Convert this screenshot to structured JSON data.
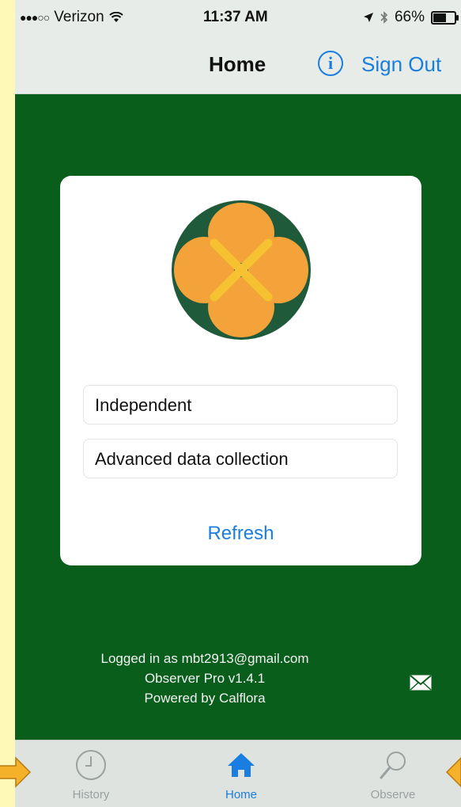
{
  "status": {
    "carrier": "Verizon",
    "time": "11:37 AM",
    "battery": "66%",
    "battery_level": 0.66
  },
  "nav": {
    "title": "Home",
    "info_icon": "info-circle-icon",
    "sign_out": "Sign Out"
  },
  "card": {
    "logo_icon": "calflora-logo",
    "field1": "Independent",
    "field2": "Advanced data collection",
    "refresh": "Refresh"
  },
  "footer": {
    "line1": "Logged in as mbt2913@gmail.com",
    "line2": "Observer Pro v1.4.1",
    "line3": "Powered by Calflora"
  },
  "tabs": [
    {
      "label": "History",
      "icon": "clock-icon"
    },
    {
      "label": "Home",
      "icon": "home-icon"
    },
    {
      "label": "Observe",
      "icon": "magnifier-icon"
    }
  ],
  "colors": {
    "accent": "#1a7ee0",
    "main_bg": "#0a5e1c",
    "logo_orange": "#f4a23a",
    "logo_yellow": "#f6c232",
    "page_bg": "#fff9b8",
    "callout_arrow": "#f6b12a"
  }
}
